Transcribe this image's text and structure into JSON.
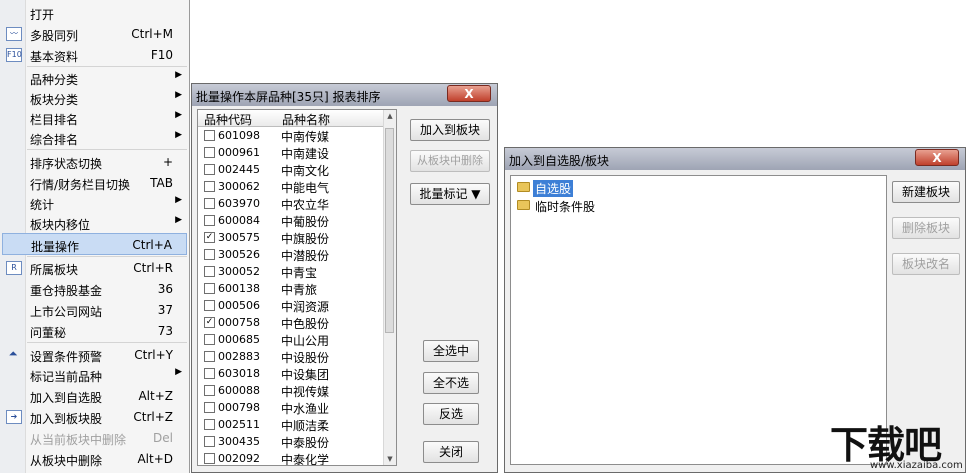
{
  "menu": {
    "items": [
      {
        "label": "打开",
        "shortcut": "",
        "icon": ""
      },
      {
        "label": "多股同列",
        "shortcut": "Ctrl+M",
        "icon": "multi-stock-chart-icon"
      },
      {
        "label": "基本资料",
        "shortcut": "F10",
        "icon": "f10-info-icon"
      },
      {
        "label": "品种分类",
        "shortcut": "",
        "submenu": true
      },
      {
        "label": "板块分类",
        "shortcut": "",
        "submenu": true
      },
      {
        "label": "栏目排名",
        "shortcut": "",
        "submenu": true
      },
      {
        "label": "综合排名",
        "shortcut": "",
        "submenu": true
      },
      {
        "label": "排序状态切换",
        "shortcut": "+"
      },
      {
        "label": "行情/财务栏目切换",
        "shortcut": "TAB"
      },
      {
        "label": "统计",
        "shortcut": "",
        "submenu": true
      },
      {
        "label": "板块内移位",
        "shortcut": "",
        "submenu": true
      },
      {
        "label": "批量操作",
        "shortcut": "Ctrl+A",
        "highlighted": true
      },
      {
        "label": "所属板块",
        "shortcut": "Ctrl+R",
        "icon": "r-block-icon"
      },
      {
        "label": "重仓持股基金",
        "shortcut": "36"
      },
      {
        "label": "上市公司网站",
        "shortcut": "37"
      },
      {
        "label": "问董秘",
        "shortcut": "73"
      },
      {
        "label": "设置条件预警",
        "shortcut": "Ctrl+Y",
        "icon": "alert-arrow-icon"
      },
      {
        "label": "标记当前品种",
        "shortcut": "",
        "submenu": true
      },
      {
        "label": "加入到自选股",
        "shortcut": "Alt+Z"
      },
      {
        "label": "加入到板块股",
        "shortcut": "Ctrl+Z",
        "icon": "add-to-block-icon"
      },
      {
        "label": "从当前板块中删除",
        "shortcut": "Del",
        "disabled": true
      },
      {
        "label": "从板块中删除",
        "shortcut": "Alt+D"
      }
    ]
  },
  "batch_dialog": {
    "title": "批量操作本屏品种[35只] 报表排序",
    "close_glyph": "X",
    "columns": [
      "品种代码",
      "品种名称"
    ],
    "rows": [
      {
        "code": "601098",
        "name": "中南传媒",
        "checked": false
      },
      {
        "code": "000961",
        "name": "中南建设",
        "checked": false
      },
      {
        "code": "002445",
        "name": "中南文化",
        "checked": false
      },
      {
        "code": "300062",
        "name": "中能电气",
        "checked": false
      },
      {
        "code": "603970",
        "name": "中农立华",
        "checked": false
      },
      {
        "code": "600084",
        "name": "中葡股份",
        "checked": false
      },
      {
        "code": "300575",
        "name": "中旗股份",
        "checked": true
      },
      {
        "code": "300526",
        "name": "中潜股份",
        "checked": false
      },
      {
        "code": "300052",
        "name": "中青宝",
        "checked": false
      },
      {
        "code": "600138",
        "name": "中青旅",
        "checked": false
      },
      {
        "code": "000506",
        "name": "中润资源",
        "checked": false
      },
      {
        "code": "000758",
        "name": "中色股份",
        "checked": true
      },
      {
        "code": "000685",
        "name": "中山公用",
        "checked": false
      },
      {
        "code": "002883",
        "name": "中设股份",
        "checked": false
      },
      {
        "code": "603018",
        "name": "中设集团",
        "checked": false
      },
      {
        "code": "600088",
        "name": "中视传媒",
        "checked": false
      },
      {
        "code": "000798",
        "name": "中水渔业",
        "checked": false
      },
      {
        "code": "002511",
        "name": "中顺洁柔",
        "checked": false
      },
      {
        "code": "300435",
        "name": "中泰股份",
        "checked": false
      },
      {
        "code": "002092",
        "name": "中泰化学",
        "checked": false
      }
    ],
    "buttons": {
      "add_to_block": "加入到板块",
      "remove_from_block": "从板块中删除",
      "batch_mark": "批量标记 ▼",
      "select_all": "全选中",
      "select_none": "全不选",
      "invert": "反选",
      "close": "关闭"
    }
  },
  "add_dialog": {
    "title": "加入到自选股/板块",
    "close_glyph": "X",
    "tree": [
      {
        "label": "自选股",
        "selected": true
      },
      {
        "label": "临时条件股",
        "selected": false
      }
    ],
    "buttons": {
      "new_block": "新建板块",
      "delete_block": "删除板块",
      "rename_block": "板块改名"
    }
  },
  "watermark": {
    "big": "下载吧",
    "small": "www.xiazaiba.com"
  }
}
